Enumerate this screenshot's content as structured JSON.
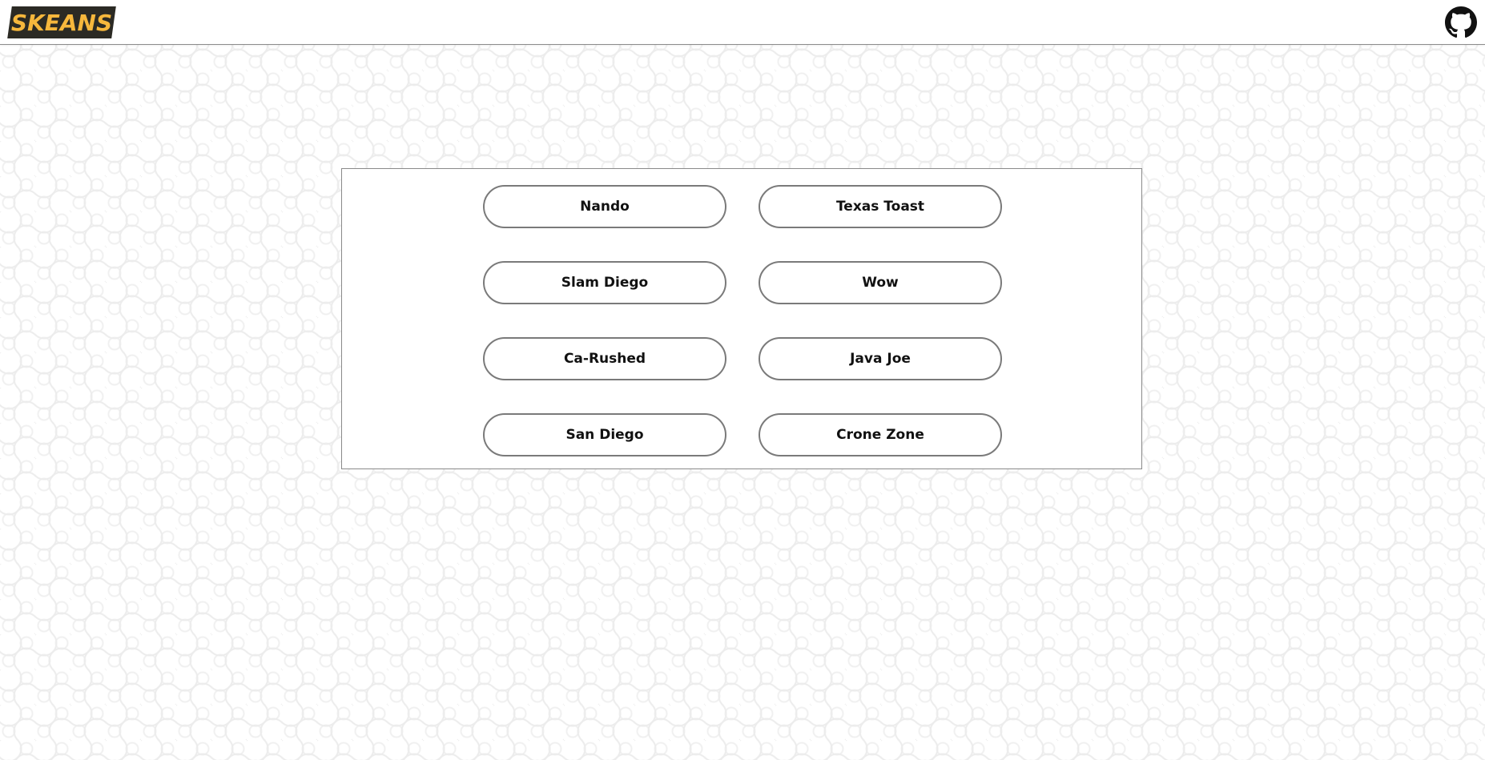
{
  "header": {
    "logo_text": "SKEANS",
    "github_icon": "github-icon"
  },
  "colors": {
    "logo_bg": "#2b2a24",
    "logo_text": "#f6b73c",
    "button_border": "#7a7a7a"
  },
  "teams": [
    {
      "label": "Nando"
    },
    {
      "label": "Texas Toast"
    },
    {
      "label": "Slam Diego"
    },
    {
      "label": "Wow"
    },
    {
      "label": "Ca-Rushed"
    },
    {
      "label": "Java Joe"
    },
    {
      "label": "San Diego"
    },
    {
      "label": "Crone Zone"
    }
  ]
}
